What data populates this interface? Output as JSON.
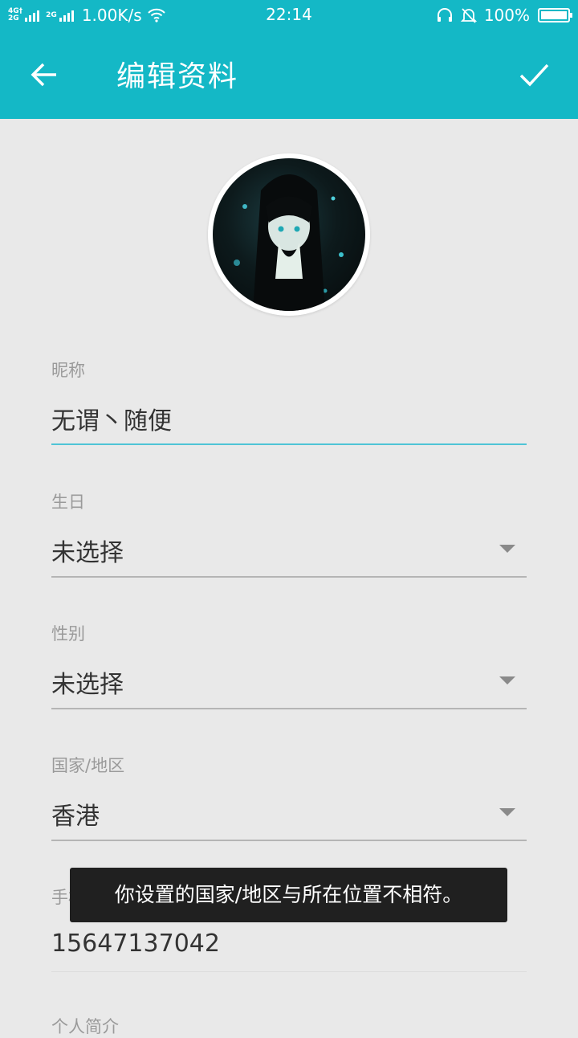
{
  "status_bar": {
    "network_type_top": "4G†",
    "network_type_bottom": "2G",
    "network_type_2": "2G",
    "net_speed": "1.00K/s",
    "time": "22:14",
    "battery": "100%",
    "icons": [
      "signal-icon",
      "wifi-icon",
      "headset-icon",
      "mute-bell-icon",
      "battery-icon"
    ]
  },
  "toolbar": {
    "title": "编辑资料",
    "back_icon": "arrow-left-icon",
    "confirm_icon": "checkmark-icon"
  },
  "form": {
    "nickname": {
      "label": "昵称",
      "value": "无谓丶随便"
    },
    "birthday": {
      "label": "生日",
      "value": "未选择"
    },
    "gender": {
      "label": "性别",
      "value": "未选择"
    },
    "region": {
      "label": "国家/地区",
      "value": "香港"
    },
    "phone": {
      "label": "手机",
      "value": "15647137042"
    },
    "bio": {
      "label": "个人简介"
    }
  },
  "toast": {
    "text": "你设置的国家/地区与所在位置不相符。"
  },
  "colors": {
    "accent": "#14b8c6",
    "background": "#e9e9e9",
    "focus_underline": "#4fc4d6"
  }
}
